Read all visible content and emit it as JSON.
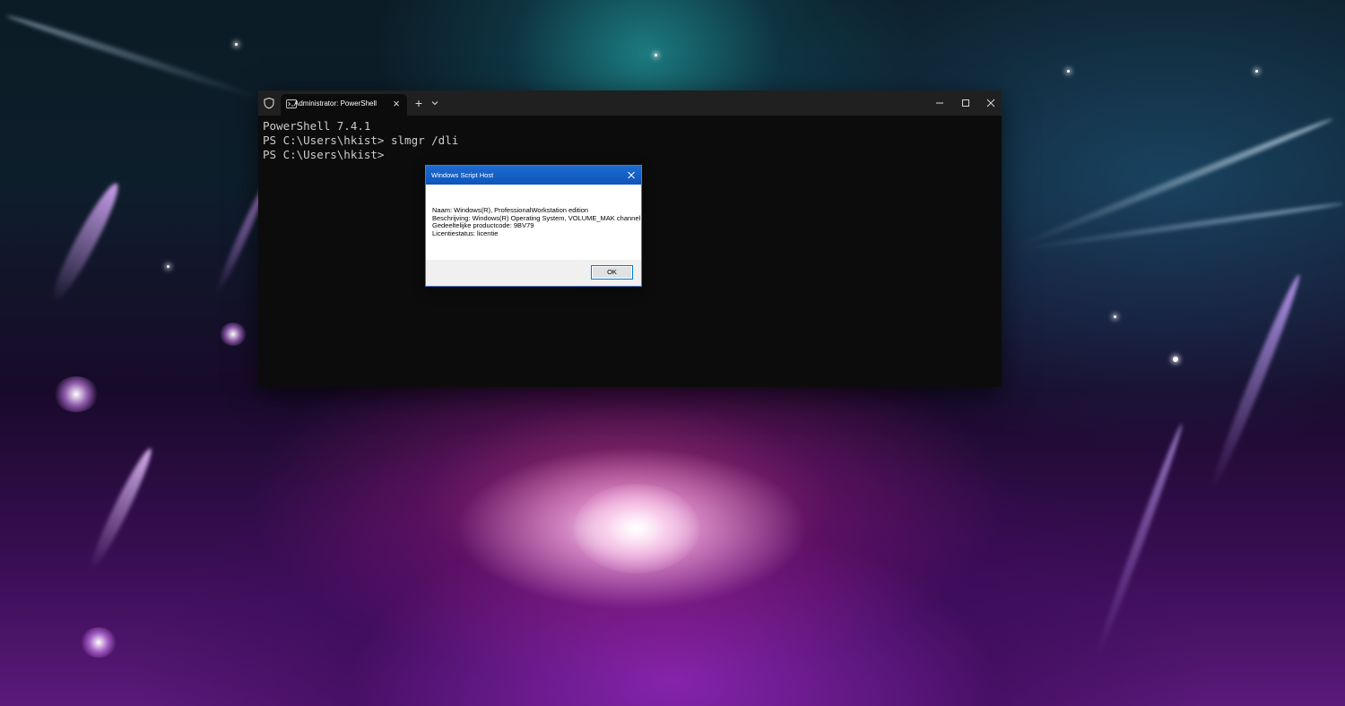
{
  "terminal": {
    "tab_title": "Administrator: PowerShell",
    "tab_close": "×",
    "new_tab": "+",
    "lines": [
      "PowerShell 7.4.1",
      "PS C:\\Users\\hkist> slmgr /dli",
      "PS C:\\Users\\hkist>"
    ]
  },
  "dialog": {
    "title": "Windows Script Host",
    "lines": [
      "Naam: Windows(R), ProfessionalWorkstation edition",
      "Beschrijving: Windows(R) Operating System, VOLUME_MAK channel",
      "Gedeeltelijke productcode: 9BV79",
      "Licentiestatus: licentie"
    ],
    "ok_label": "OK"
  },
  "colors": {
    "terminal_bg": "#0c0c0c",
    "titlebar_bg": "#202020",
    "dialog_title_bg": "#0d55bb",
    "ok_border": "#0078d7"
  }
}
